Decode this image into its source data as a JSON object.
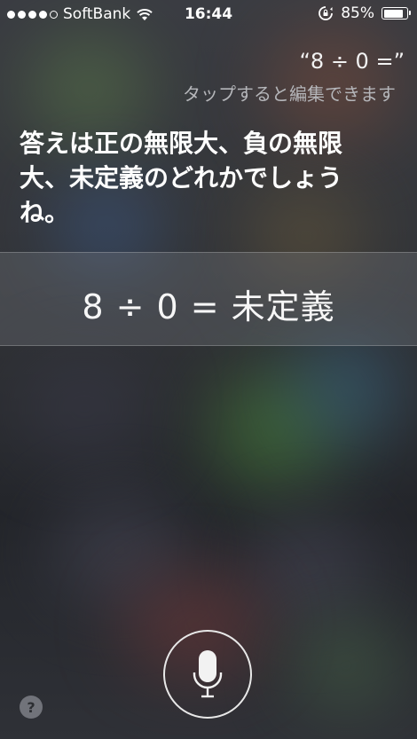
{
  "status_bar": {
    "signal_bars": 4,
    "signal_total": 5,
    "carrier": "SoftBank",
    "time": "16:44",
    "battery_percent_label": "85%",
    "battery_level": 0.85,
    "icons": [
      "wifi-icon",
      "rotation-lock-icon",
      "battery-icon"
    ]
  },
  "siri": {
    "query": "“8 ÷ 0 =”",
    "tap_to_edit": "タップすると編集できます",
    "answer_lines": [
      "答えは正の無限大、負の無限",
      "大、未定義のどれかでしょう",
      "ね。"
    ],
    "result": "8 ÷ 0 = 未定義",
    "help_label": "?",
    "mic_icon": "microphone-icon"
  }
}
